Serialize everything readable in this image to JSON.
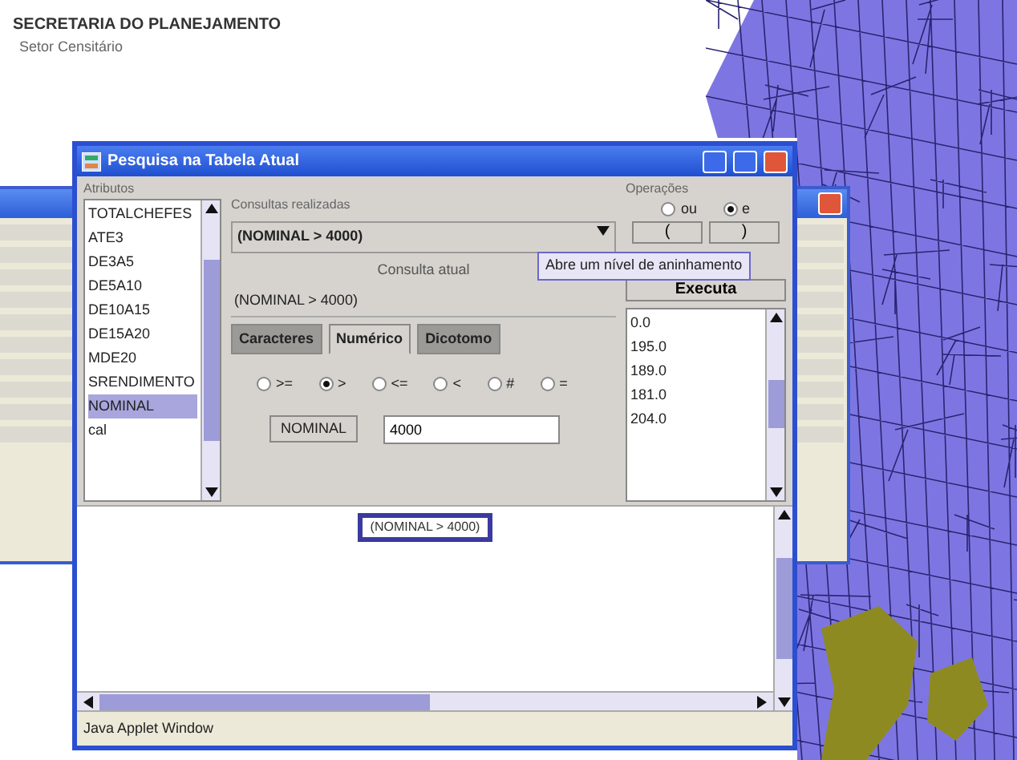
{
  "header": {
    "title": "SECRETARIA DO PLANEJAMENTO",
    "subtitle": "Setor Censitário"
  },
  "dialog": {
    "title": "Pesquisa na Tabela Atual",
    "attributes": {
      "label": "Atributos",
      "items": [
        {
          "text": "TOTALCHEFES",
          "selected": false
        },
        {
          "text": "ATE3",
          "selected": false
        },
        {
          "text": "DE3A5",
          "selected": false
        },
        {
          "text": "DE5A10",
          "selected": false
        },
        {
          "text": "DE10A15",
          "selected": false
        },
        {
          "text": "DE15A20",
          "selected": false
        },
        {
          "text": "MDE20",
          "selected": false
        },
        {
          "text": "SRENDIMENTO",
          "selected": false
        },
        {
          "text": "NOMINAL",
          "selected": true
        },
        {
          "text": "cal",
          "selected": false
        }
      ]
    },
    "queries": {
      "label": "Consultas realizadas",
      "value": "(NOMINAL > 4000)"
    },
    "current": {
      "label": "Consulta atual",
      "value": "(NOMINAL > 4000)"
    },
    "tabs": [
      {
        "label": "Caracteres",
        "selected": false
      },
      {
        "label": "Numérico",
        "selected": true
      },
      {
        "label": "Dicotomo",
        "selected": false
      }
    ],
    "comparators": [
      {
        "label": ">=",
        "checked": false
      },
      {
        "label": ">",
        "checked": true
      },
      {
        "label": "<=",
        "checked": false
      },
      {
        "label": "<",
        "checked": false
      },
      {
        "label": "#",
        "checked": false
      },
      {
        "label": "=",
        "checked": false
      }
    ],
    "field": {
      "label": "NOMINAL",
      "value": "4000"
    },
    "operations": {
      "label": "Operações",
      "connectors": [
        {
          "label": "ou",
          "checked": false
        },
        {
          "label": "e",
          "checked": true
        }
      ],
      "buttons": [
        "(",
        ")"
      ],
      "execute": "Executa",
      "values": [
        "0.0",
        "195.0",
        "189.0",
        "181.0",
        "204.0"
      ]
    },
    "tooltip": "Abre um nível de aninhamento",
    "result": "(NOMINAL > 4000)",
    "status": "Java Applet Window"
  }
}
